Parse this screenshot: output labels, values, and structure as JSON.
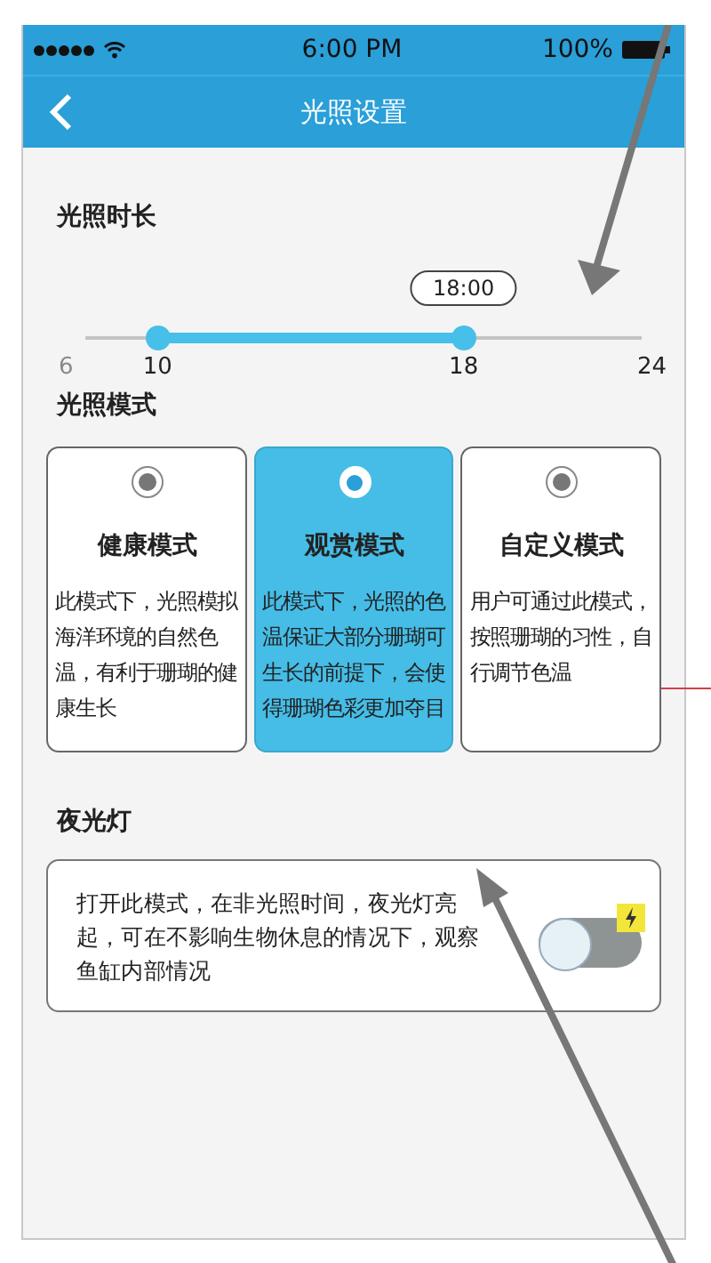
{
  "status_bar": {
    "time": "6:00 PM",
    "battery": "100%"
  },
  "nav": {
    "title": "光照设置"
  },
  "duration": {
    "heading": "光照时长",
    "tooltip": "18:00",
    "min_label": "6",
    "max_label": "24",
    "low": {
      "level": 0.13,
      "label": "10"
    },
    "high": {
      "level": 0.68,
      "label": "18"
    }
  },
  "modes": {
    "heading": "光照模式",
    "items": [
      {
        "title": "健康模式",
        "description": "此模式下，光照模拟海洋环境的自然色温，有利于珊瑚的健康生长",
        "selected": false
      },
      {
        "title": "观赏模式",
        "description": "此模式下，光照的色温保证大部分珊瑚可生长的前提下，会使得珊瑚色彩更加夺目",
        "selected": true
      },
      {
        "title": "自定义模式",
        "description": "用户可通过此模式，按照珊瑚的习性，自行调节色温",
        "selected": false
      }
    ]
  },
  "night_light": {
    "heading": "夜光灯",
    "description": "打开此模式，在非光照时间，夜光灯亮起，可在不影响生物休息的情况下，观察鱼缸内部情况",
    "on": false
  }
}
